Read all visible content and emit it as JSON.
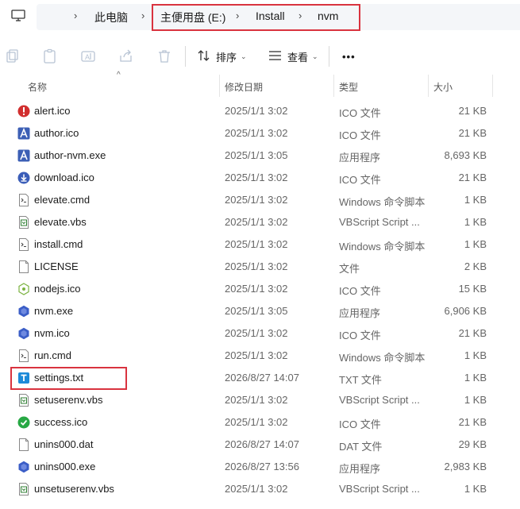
{
  "address": {
    "crumbs": [
      "此电脑",
      "主便用盘 (E:)",
      "Install",
      "nvm"
    ]
  },
  "toolbar": {
    "sort_label": "排序",
    "view_label": "查看",
    "more_label": "•••"
  },
  "columns": {
    "name": "名称",
    "date": "修改日期",
    "type": "类型",
    "size": "大小"
  },
  "files": [
    {
      "name": "alert.ico",
      "date": "2025/1/1 3:02",
      "type": "ICO 文件",
      "size": "21 KB",
      "icon": "alert-icon"
    },
    {
      "name": "author.ico",
      "date": "2025/1/1 3:02",
      "type": "ICO 文件",
      "size": "21 KB",
      "icon": "author-icon"
    },
    {
      "name": "author-nvm.exe",
      "date": "2025/1/1 3:05",
      "type": "应用程序",
      "size": "8,693 KB",
      "icon": "author-icon"
    },
    {
      "name": "download.ico",
      "date": "2025/1/1 3:02",
      "type": "ICO 文件",
      "size": "21 KB",
      "icon": "download-icon"
    },
    {
      "name": "elevate.cmd",
      "date": "2025/1/1 3:02",
      "type": "Windows 命令脚本",
      "size": "1 KB",
      "icon": "script-icon"
    },
    {
      "name": "elevate.vbs",
      "date": "2025/1/1 3:02",
      "type": "VBScript Script ...",
      "size": "1 KB",
      "icon": "vbs-icon"
    },
    {
      "name": "install.cmd",
      "date": "2025/1/1 3:02",
      "type": "Windows 命令脚本",
      "size": "1 KB",
      "icon": "script-icon"
    },
    {
      "name": "LICENSE",
      "date": "2025/1/1 3:02",
      "type": "文件",
      "size": "2 KB",
      "icon": "file-icon"
    },
    {
      "name": "nodejs.ico",
      "date": "2025/1/1 3:02",
      "type": "ICO 文件",
      "size": "15 KB",
      "icon": "nodejs-icon"
    },
    {
      "name": "nvm.exe",
      "date": "2025/1/1 3:05",
      "type": "应用程序",
      "size": "6,906 KB",
      "icon": "nvm-icon"
    },
    {
      "name": "nvm.ico",
      "date": "2025/1/1 3:02",
      "type": "ICO 文件",
      "size": "21 KB",
      "icon": "nvm-icon"
    },
    {
      "name": "run.cmd",
      "date": "2025/1/1 3:02",
      "type": "Windows 命令脚本",
      "size": "1 KB",
      "icon": "script-icon"
    },
    {
      "name": "settings.txt",
      "date": "2026/8/27 14:07",
      "type": "TXT 文件",
      "size": "1 KB",
      "icon": "txt-icon"
    },
    {
      "name": "setuserenv.vbs",
      "date": "2025/1/1 3:02",
      "type": "VBScript Script ...",
      "size": "1 KB",
      "icon": "vbs-icon"
    },
    {
      "name": "success.ico",
      "date": "2025/1/1 3:02",
      "type": "ICO 文件",
      "size": "21 KB",
      "icon": "success-icon"
    },
    {
      "name": "unins000.dat",
      "date": "2026/8/27 14:07",
      "type": "DAT 文件",
      "size": "29 KB",
      "icon": "file-icon"
    },
    {
      "name": "unins000.exe",
      "date": "2026/8/27 13:56",
      "type": "应用程序",
      "size": "2,983 KB",
      "icon": "nvm-icon"
    },
    {
      "name": "unsetuserenv.vbs",
      "date": "2025/1/1 3:02",
      "type": "VBScript Script ...",
      "size": "1 KB",
      "icon": "vbs-icon"
    }
  ]
}
